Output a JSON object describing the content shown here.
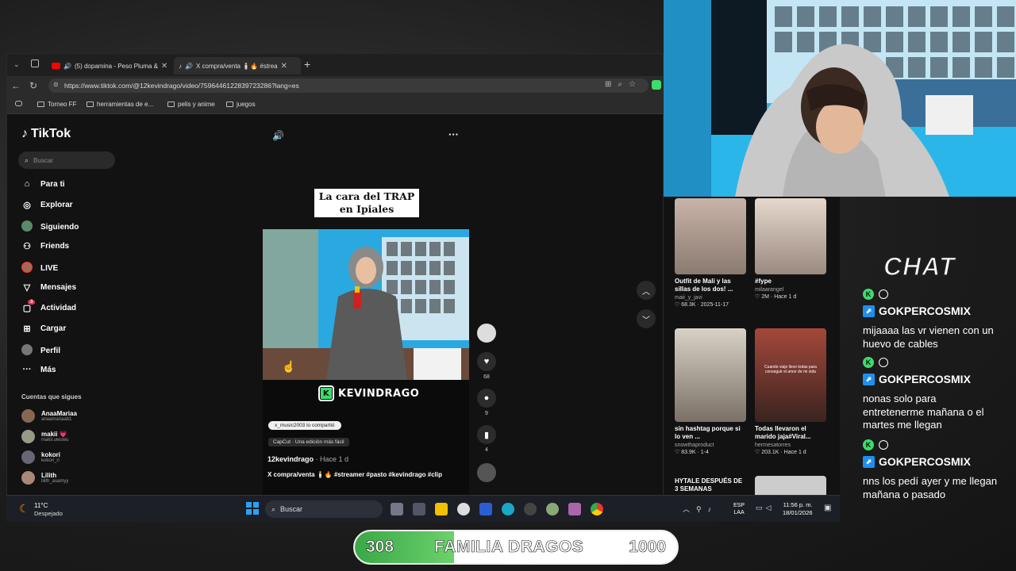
{
  "browser": {
    "tabs": [
      {
        "title": "(5) dopamina - Peso Pluma &",
        "active": false
      },
      {
        "title": "X compra/venta 🕯️🔥 #strea",
        "active": true
      }
    ],
    "url": "https://www.tiktok.com/@12kevindrago/video/7596446122839723286?lang=es",
    "bookmarks": [
      "Torneo FF",
      "herramientas de e...",
      "pelis y anime",
      "juegos"
    ]
  },
  "tiktok": {
    "logo": "TikTok",
    "search_placeholder": "Buscar",
    "nav": [
      {
        "label": "Para ti",
        "icon": "home-icon"
      },
      {
        "label": "Explorar",
        "icon": "compass-icon"
      },
      {
        "label": "Siguiendo",
        "icon": "following-icon"
      },
      {
        "label": "Friends",
        "icon": "friends-icon"
      },
      {
        "label": "LIVE",
        "icon": "live-icon"
      },
      {
        "label": "Mensajes",
        "icon": "send-icon"
      },
      {
        "label": "Actividad",
        "icon": "activity-icon",
        "badge": "3"
      },
      {
        "label": "Cargar",
        "icon": "upload-icon"
      },
      {
        "label": "Perfil",
        "icon": "profile-icon"
      },
      {
        "label": "Más",
        "icon": "more-icon"
      }
    ],
    "following_header": "Cuentas que sigues",
    "following": [
      {
        "name": "AnaaMariaa",
        "user": "anaamariaab1"
      },
      {
        "name": "makii 💗",
        "user": "makii.uwuwu"
      },
      {
        "name": "kokori",
        "user": "kokori_ri"
      },
      {
        "name": "Lilith",
        "user": "lilith_asamyy"
      }
    ],
    "video": {
      "caption": "La cara del TRAP en Ipiales",
      "watermark": "KEVINDRAGO",
      "shared_chip": "x_music2003 lo compartió",
      "capcut_chip": "CapCut · Una edición más fácil",
      "author": "12kevindrago",
      "time": "· Hace 1 d",
      "description": "X compra/venta 🕯️🔥 #streamer #pasto #kevindrago #clip",
      "likes": "68",
      "comments": "9",
      "saves": "4"
    },
    "suggestions": [
      {
        "title": "Outfit de Mali y las sillas de los dos! ...",
        "user": "maii_y_javi",
        "views": "68.3K",
        "date": "2025-11-17"
      },
      {
        "title": "#fype",
        "user": "milaarangel",
        "views": "2M",
        "date": "Hace 1 d"
      },
      {
        "title": "sin hashtag porque si lo ven ...",
        "user": "snowthaproduct",
        "views": "83.9K",
        "date": "1-4"
      },
      {
        "title": "Todas llevaron el marido jaja#Viral...",
        "user": "hermesatorres",
        "views": "203.1K",
        "date": "Hace 1 d"
      },
      {
        "title": "HYTALE DESPUÉS DE 3 SEMANAS",
        "user": "",
        "views": "",
        "date": ""
      }
    ],
    "suggestion_thumb_text": "Cuando viajo llevo todas para conseguir el amor de mi vida"
  },
  "taskbar": {
    "weather_temp": "11°C",
    "weather_desc": "Despejado",
    "search": "Buscar",
    "lang1": "ESP",
    "lang2": "LAA",
    "time": "11:56 p. m.",
    "date": "18/01/2026"
  },
  "chat": {
    "title": "CHAT",
    "messages": [
      {
        "user": "GOKPERCOSMIX",
        "text": "mijaaaa las vr vienen con un huevo de cables"
      },
      {
        "user": "GOKPERCOSMIX",
        "text": "nonas solo para entretenerme mañana o el martes me llegan"
      },
      {
        "user": "GOKPERCOSMIX",
        "text": "nns los pedí ayer y me llegan mañana o pasado"
      }
    ]
  },
  "goal": {
    "current": "308",
    "title": "FAMILIA DRAGOS",
    "target": "1000",
    "progress": 0.308
  },
  "colors": {
    "accent_green": "#3ddc6b",
    "chat_blue": "#1d8ff0"
  }
}
